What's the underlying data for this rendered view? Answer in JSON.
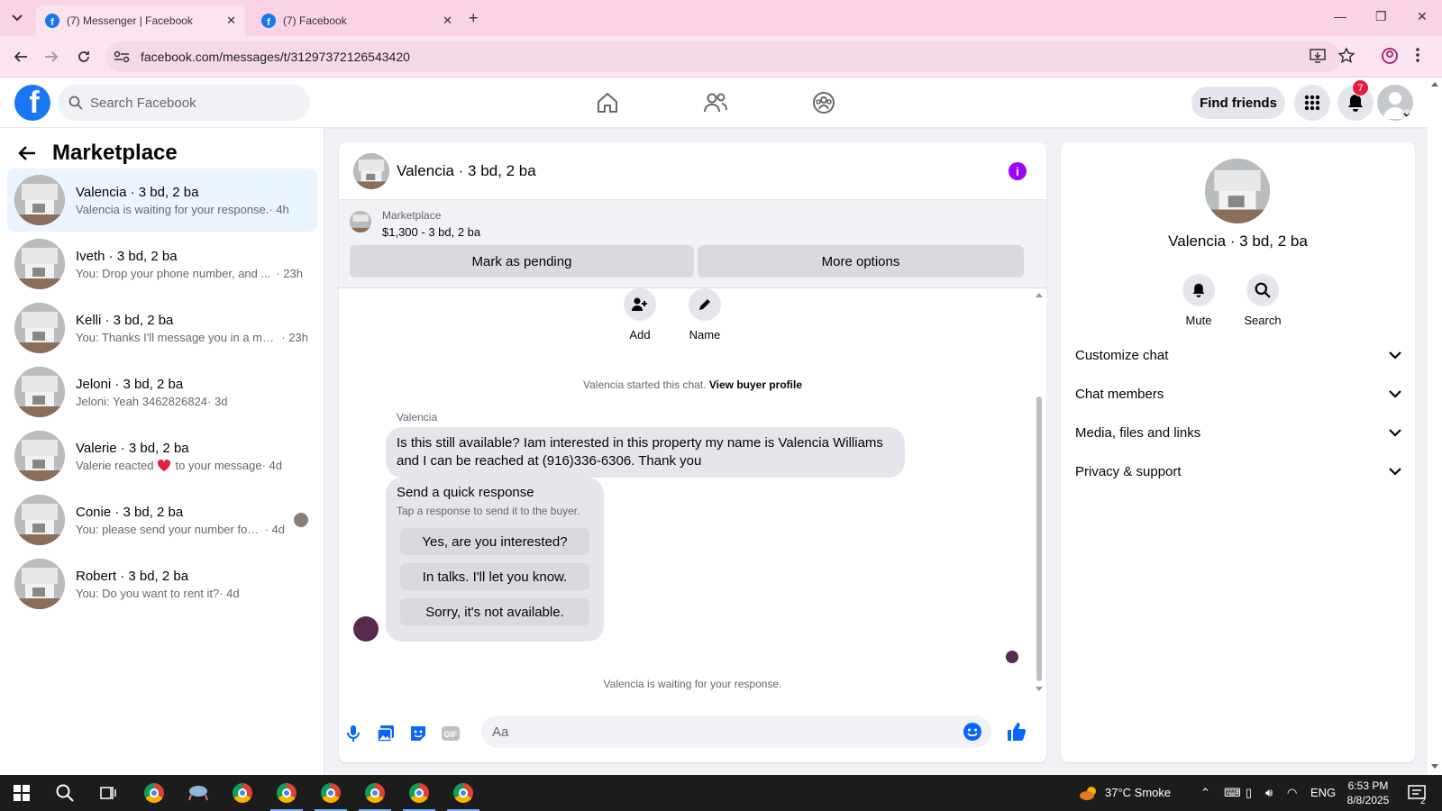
{
  "browser": {
    "tabs": [
      {
        "title": "(7) Messenger | Facebook",
        "active": true
      },
      {
        "title": "(7) Facebook",
        "active": false
      }
    ],
    "url": "facebook.com/messages/t/31297372126543420"
  },
  "fb_header": {
    "search_placeholder": "Search Facebook",
    "find_friends_label": "Find friends",
    "notification_count": "7",
    "brand_color": "#1877f2"
  },
  "sidebar": {
    "title": "Marketplace",
    "conversations": [
      {
        "name": "Valencia · 3 bd, 2 ba",
        "preview": "Valencia is waiting for your response.",
        "time": "· 4h",
        "active": true
      },
      {
        "name": "Iveth · 3 bd, 2 ba",
        "preview": "You: Drop your phone number, and ...",
        "time": "· 23h"
      },
      {
        "name": "Kelli · 3 bd, 2 ba",
        "preview": "You: Thanks I'll message you in a mo...",
        "time": "· 23h"
      },
      {
        "name": "Jeloni · 3 bd, 2 ba",
        "preview": "Jeloni: Yeah 3462826824",
        "time": "· 3d"
      },
      {
        "name": "Valerie · 3 bd, 2 ba",
        "preview_before": "Valerie reacted",
        "preview_after": "to your message",
        "time": "· 4d"
      },
      {
        "name": "Conie · 3 bd, 2 ba",
        "preview": "You: please send your number for ...",
        "time": "· 4d"
      },
      {
        "name": "Robert · 3 bd, 2 ba",
        "preview": "You: Do you want to rent it?",
        "time": "· 4d"
      }
    ]
  },
  "chat": {
    "title": "Valencia · 3 bd, 2 ba",
    "marketplace_label": "Marketplace",
    "listing": "$1,300 - 3 bd, 2 ba",
    "mark_pending": "Mark as pending",
    "more_options": "More options",
    "add_label": "Add",
    "name_label": "Name",
    "started_text": "Valencia started this chat.",
    "view_profile": "View buyer profile",
    "sender": "Valencia",
    "message": "Is this still available? Iam interested in this property my name is Valencia Williams and I can be reached at (916)336-6306. Thank you",
    "quick_title": "Send a quick response",
    "quick_subtitle": "Tap a response to send it to the buyer.",
    "quick_responses": [
      "Yes, are you interested?",
      "In talks. I'll let you know.",
      "Sorry, it's not available."
    ],
    "waiting_text": "Valencia is waiting for your response.",
    "composer_placeholder": "Aa"
  },
  "details": {
    "name": "Valencia · 3 bd, 2 ba",
    "mute_label": "Mute",
    "search_label": "Search",
    "sections": [
      "Customize chat",
      "Chat members",
      "Media, files and links",
      "Privacy & support"
    ]
  },
  "taskbar": {
    "weather": "37°C  Smoke",
    "lang": "ENG",
    "time": "6:53 PM",
    "date": "8/8/2025",
    "notif_count": "2"
  }
}
